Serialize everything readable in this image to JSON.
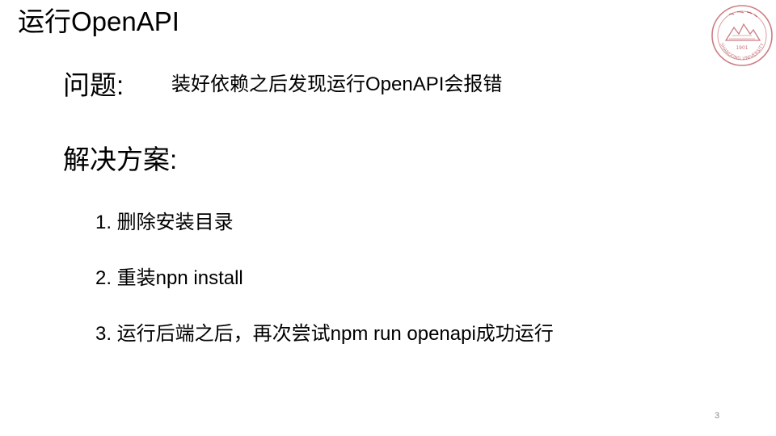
{
  "slide": {
    "title": "运行OpenAPI",
    "problem": {
      "label": "问题:",
      "text": "装好依赖之后发现运行OpenAPI会报错"
    },
    "solution": {
      "label": "解决方案:",
      "steps": [
        "1. 删除安装目录",
        "2. 重装npn install",
        "3. 运行后端之后，再次尝试npm run openapi成功运行"
      ]
    },
    "page_number": "3",
    "logo": {
      "icon": "university-seal-icon",
      "text": "SHANDONG UNIVERSITY",
      "year": "1901",
      "color": "#a3101e"
    }
  }
}
